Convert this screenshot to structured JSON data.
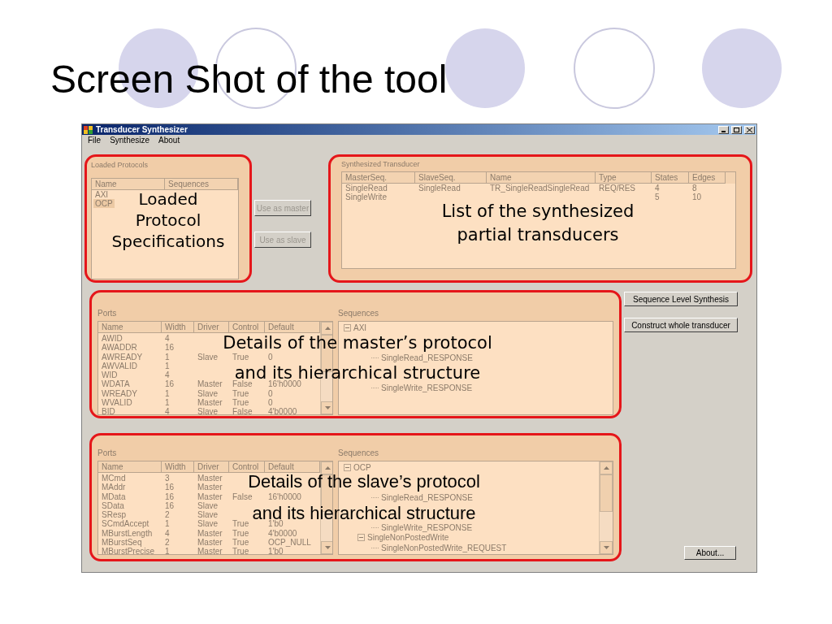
{
  "slide": {
    "title": "Screen Shot of the tool"
  },
  "window": {
    "title": "Transducer Synthesizer",
    "menu": [
      "File",
      "Synthesize",
      "About"
    ]
  },
  "loaded_protocols": {
    "title": "Loaded Protocols",
    "columns": [
      "Name",
      "Sequences"
    ],
    "rows": [
      {
        "name": "AXI",
        "selected": false
      },
      {
        "name": "OCP",
        "selected": true
      }
    ]
  },
  "protocol_buttons": [
    {
      "label": "Use as master",
      "disabled": true
    },
    {
      "label": "Use as slave",
      "disabled": true
    }
  ],
  "synthesized": {
    "title": "Synthesized Transducer",
    "columns": [
      "MasterSeq.",
      "SlaveSeq.",
      "Name",
      "Type",
      "States",
      "Edges"
    ],
    "rows": [
      [
        "SingleRead",
        "SingleRead",
        "TR_SingleReadSingleRead",
        "REQ/RES",
        "4",
        "8"
      ],
      [
        "SingleWrite",
        null,
        null,
        null,
        "5",
        "10"
      ]
    ]
  },
  "master": {
    "ports_label": "Ports",
    "sequences_label": "Sequences",
    "columns": [
      "Name",
      "Width",
      "Driver",
      "Control",
      "Default"
    ],
    "rows": [
      [
        "AWID",
        "4",
        null,
        null,
        null
      ],
      [
        "AWADDR",
        "16",
        null,
        null,
        null
      ],
      [
        "AWREADY",
        "1",
        "Slave",
        "True",
        "0"
      ],
      [
        "AWVALID",
        "1",
        null,
        null,
        null
      ],
      [
        "WID",
        "4",
        null,
        null,
        null
      ],
      [
        "WDATA",
        "16",
        "Master",
        "False",
        "16'h0000"
      ],
      [
        "WREADY",
        "1",
        "Slave",
        "True",
        "0"
      ],
      [
        "WVALID",
        "1",
        "Master",
        "True",
        "0"
      ],
      [
        "BID",
        "4",
        "Slave",
        "False",
        "4'b0000"
      ]
    ],
    "tree": [
      {
        "kind": "node",
        "label": "AXI",
        "expanded": true,
        "children": [
          {
            "kind": "covered",
            "children": [
              {
                "kind": "covered"
              },
              {
                "kind": "node",
                "label": "SingleRead_RESPONSE"
              }
            ]
          },
          {
            "kind": "covered",
            "children": [
              {
                "kind": "covered"
              },
              {
                "kind": "node",
                "label": "SingleWrite_RESPONSE"
              }
            ]
          }
        ]
      }
    ],
    "tree_scrollbar": false
  },
  "slave": {
    "ports_label": "Ports",
    "sequences_label": "Sequences",
    "columns": [
      "Name",
      "Width",
      "Driver",
      "Control",
      "Default"
    ],
    "rows": [
      [
        "MCmd",
        "3",
        "Master",
        null,
        null
      ],
      [
        "MAddr",
        "16",
        "Master",
        null,
        null
      ],
      [
        "MData",
        "16",
        "Master",
        "False",
        "16'h0000"
      ],
      [
        "SData",
        "16",
        "Slave",
        null,
        null
      ],
      [
        "SResp",
        "2",
        "Slave",
        null,
        null
      ],
      [
        "SCmdAccept",
        "1",
        "Slave",
        "True",
        "1'b0"
      ],
      [
        "MBurstLength",
        "4",
        "Master",
        "True",
        "4'b0000"
      ],
      [
        "MBurstSeq",
        "2",
        "Master",
        "True",
        "OCP_NULL"
      ],
      [
        "MBurstPrecise",
        "1",
        "Master",
        "True",
        "1'b0"
      ]
    ],
    "tree": [
      {
        "kind": "node",
        "label": "OCP",
        "expanded": true,
        "children": [
          {
            "kind": "covered",
            "children": [
              {
                "kind": "covered"
              },
              {
                "kind": "node",
                "label": "SingleRead_RESPONSE"
              }
            ]
          },
          {
            "kind": "covered",
            "children": [
              {
                "kind": "covered"
              },
              {
                "kind": "node",
                "label": "SingleWrite_RESPONSE"
              }
            ]
          },
          {
            "kind": "node",
            "label": "SingleNonPostedWrite",
            "expanded": true,
            "children": [
              {
                "kind": "node",
                "label": "SingleNonPostedWrite_REQUEST"
              }
            ]
          }
        ]
      }
    ],
    "tree_scrollbar": true
  },
  "actions": [
    {
      "label": "Sequence Level Synthesis"
    },
    {
      "label": "Construct whole transducer"
    }
  ],
  "about_button": {
    "label": "About..."
  },
  "annotations": [
    {
      "lines": [
        "Loaded",
        "Protocol",
        "Specifications"
      ]
    },
    {
      "lines": [
        "List of the synthesized",
        "partial transducers"
      ]
    },
    {
      "lines": [
        "Details of the master’s protocol",
        "and its hierarchical structure"
      ]
    },
    {
      "lines": [
        "Details of the slave’s protocol",
        "and its hierarchical structure"
      ]
    }
  ]
}
